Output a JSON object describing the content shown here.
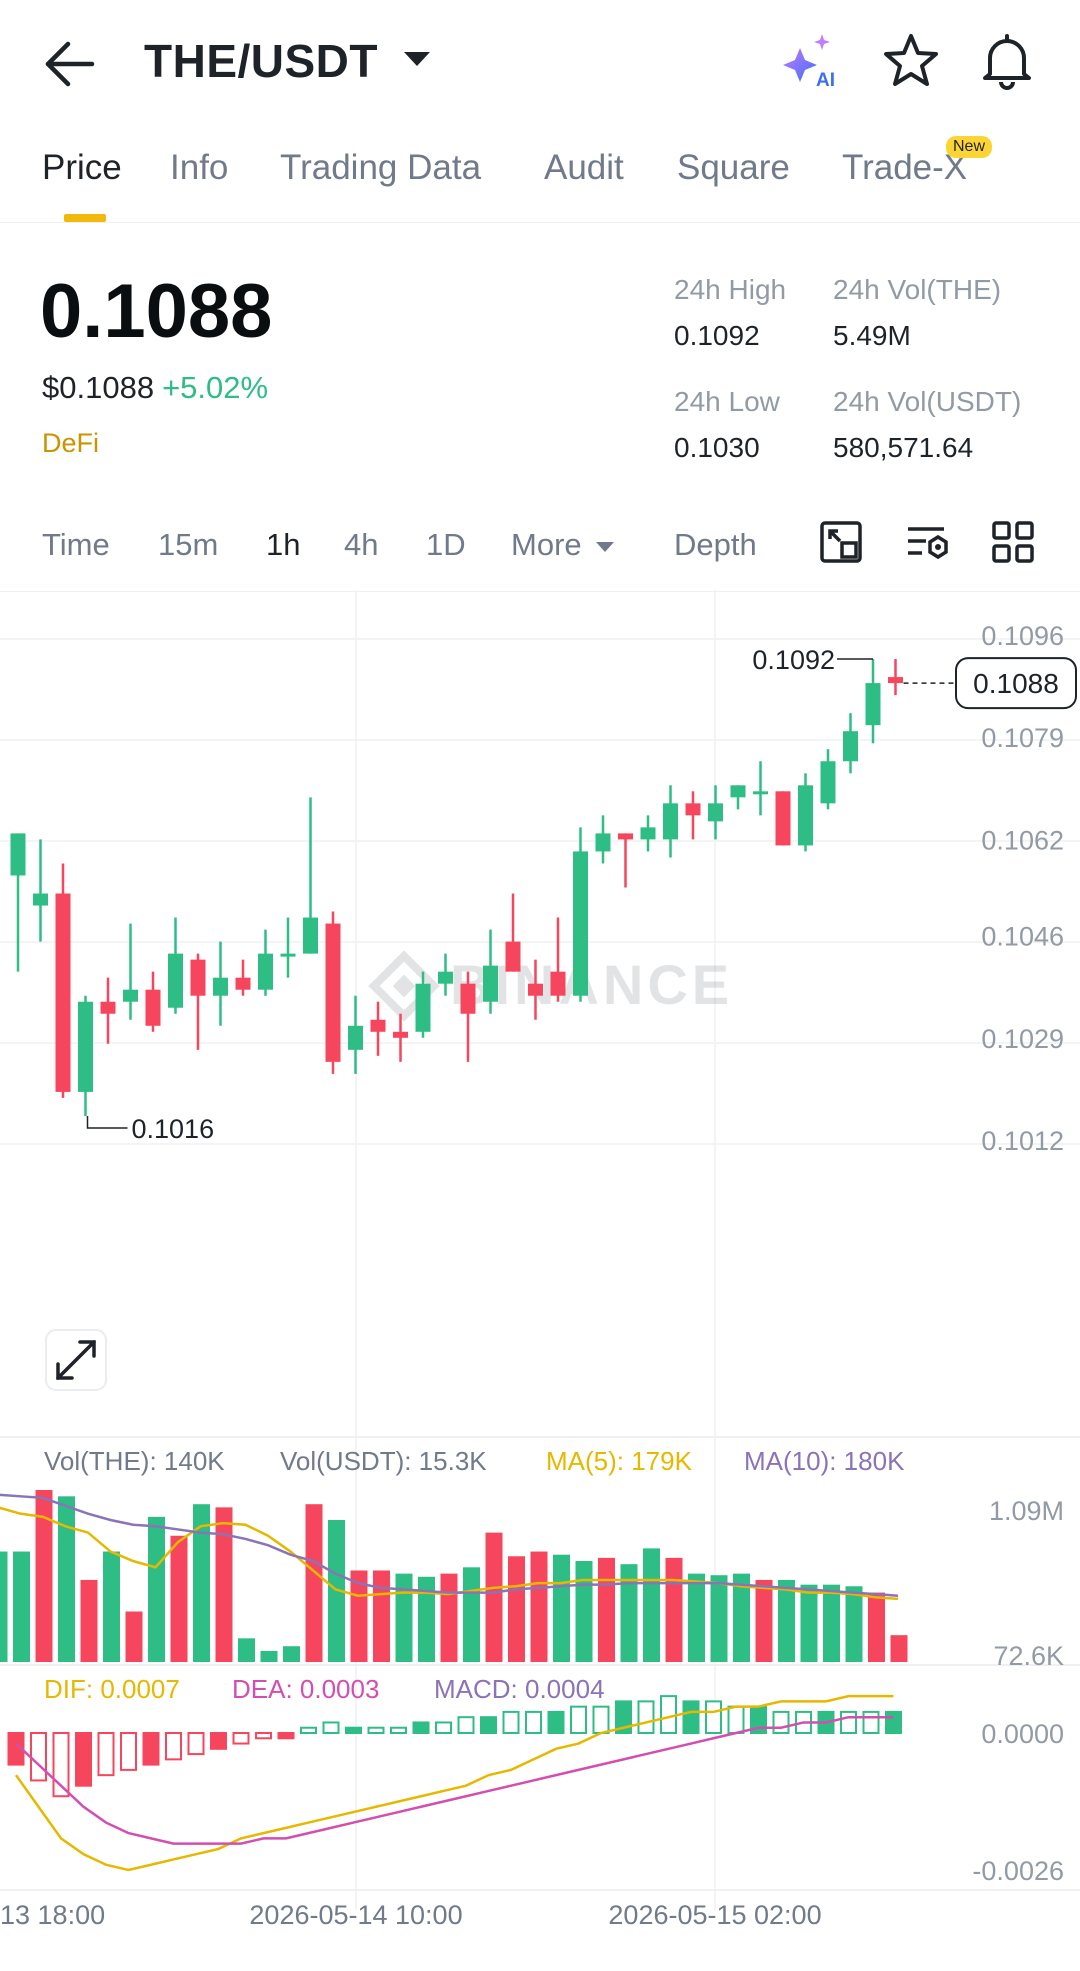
{
  "header": {
    "pair": "THE/USDT",
    "ai_label": "AI"
  },
  "tabs": [
    {
      "label": "Price",
      "active": true
    },
    {
      "label": "Info"
    },
    {
      "label": "Trading Data"
    },
    {
      "label": "Audit"
    },
    {
      "label": "Square"
    },
    {
      "label": "Trade-X",
      "badge": "New"
    }
  ],
  "price": {
    "last": "0.1088",
    "usd": "$0.1088",
    "change": "+5.02%",
    "tag": "DeFi",
    "stats": {
      "high_label": "24h High",
      "high": "0.1092",
      "vol_the_label": "24h Vol(THE)",
      "vol_the": "5.49M",
      "low_label": "24h Low",
      "low": "0.1030",
      "vol_usdt_label": "24h Vol(USDT)",
      "vol_usdt": "580,571.64"
    }
  },
  "intervals": {
    "items": [
      "Time",
      "15m",
      "1h",
      "4h",
      "1D"
    ],
    "active": "1h",
    "more": "More",
    "depth": "Depth"
  },
  "colors": {
    "up": "#2ebd85",
    "down": "#f6465d",
    "ma5": "#e6b800",
    "ma10": "#8b73b8",
    "dea": "#d24fb0",
    "accent": "#f0b90b"
  },
  "chart_data": [
    {
      "type": "candlestick",
      "interval": "1h",
      "watermark": "BINANCE",
      "y_ticks": [
        "0.1096",
        "0.1079",
        "0.1062",
        "0.1046",
        "0.1029",
        "0.1012"
      ],
      "ylim": [
        0.1012,
        0.1096
      ],
      "last_price_label": "0.1088",
      "high_marker": "0.1092",
      "low_marker": "0.1016",
      "x_tick_labels": [
        "13 18:00",
        "2026-05-14 10:00",
        "2026-05-15 02:00"
      ],
      "candles": [
        {
          "o": 0.1056,
          "h": 0.1062,
          "l": 0.104,
          "c": 0.1063
        },
        {
          "o": 0.1051,
          "h": 0.1062,
          "l": 0.1045,
          "c": 0.1053
        },
        {
          "o": 0.1053,
          "h": 0.1058,
          "l": 0.1019,
          "c": 0.102
        },
        {
          "o": 0.102,
          "h": 0.1036,
          "l": 0.1016,
          "c": 0.1035
        },
        {
          "o": 0.1035,
          "h": 0.1039,
          "l": 0.1028,
          "c": 0.1033
        },
        {
          "o": 0.1035,
          "h": 0.1048,
          "l": 0.1032,
          "c": 0.1037
        },
        {
          "o": 0.1037,
          "h": 0.104,
          "l": 0.103,
          "c": 0.1031
        },
        {
          "o": 0.1034,
          "h": 0.1049,
          "l": 0.1033,
          "c": 0.1043
        },
        {
          "o": 0.1042,
          "h": 0.1043,
          "l": 0.1027,
          "c": 0.1036
        },
        {
          "o": 0.1036,
          "h": 0.1045,
          "l": 0.1031,
          "c": 0.1039
        },
        {
          "o": 0.1039,
          "h": 0.1042,
          "l": 0.1036,
          "c": 0.1037
        },
        {
          "o": 0.1037,
          "h": 0.1047,
          "l": 0.1036,
          "c": 0.1043
        },
        {
          "o": 0.1043,
          "h": 0.1049,
          "l": 0.1039,
          "c": 0.1043
        },
        {
          "o": 0.1043,
          "h": 0.1069,
          "l": 0.1043,
          "c": 0.1049
        },
        {
          "o": 0.1048,
          "h": 0.105,
          "l": 0.1023,
          "c": 0.1025
        },
        {
          "o": 0.1027,
          "h": 0.1036,
          "l": 0.1023,
          "c": 0.1031
        },
        {
          "o": 0.1032,
          "h": 0.1035,
          "l": 0.1026,
          "c": 0.103
        },
        {
          "o": 0.103,
          "h": 0.1033,
          "l": 0.1025,
          "c": 0.1029
        },
        {
          "o": 0.103,
          "h": 0.104,
          "l": 0.1029,
          "c": 0.1038
        },
        {
          "o": 0.1038,
          "h": 0.1043,
          "l": 0.1036,
          "c": 0.104
        },
        {
          "o": 0.1038,
          "h": 0.104,
          "l": 0.1025,
          "c": 0.1033
        },
        {
          "o": 0.1035,
          "h": 0.1047,
          "l": 0.1033,
          "c": 0.1041
        },
        {
          "o": 0.1045,
          "h": 0.1053,
          "l": 0.104,
          "c": 0.104
        },
        {
          "o": 0.1038,
          "h": 0.1042,
          "l": 0.1032,
          "c": 0.1036
        },
        {
          "o": 0.104,
          "h": 0.1049,
          "l": 0.1035,
          "c": 0.1036
        },
        {
          "o": 0.1036,
          "h": 0.1064,
          "l": 0.1035,
          "c": 0.106
        },
        {
          "o": 0.106,
          "h": 0.1066,
          "l": 0.1058,
          "c": 0.1063
        },
        {
          "o": 0.1063,
          "h": 0.1063,
          "l": 0.1054,
          "c": 0.1062
        },
        {
          "o": 0.1062,
          "h": 0.1066,
          "l": 0.106,
          "c": 0.1064
        },
        {
          "o": 0.1062,
          "h": 0.1071,
          "l": 0.1059,
          "c": 0.1068
        },
        {
          "o": 0.1068,
          "h": 0.107,
          "l": 0.1062,
          "c": 0.1066
        },
        {
          "o": 0.1065,
          "h": 0.1071,
          "l": 0.1062,
          "c": 0.1068
        },
        {
          "o": 0.1069,
          "h": 0.1071,
          "l": 0.1067,
          "c": 0.1071
        },
        {
          "o": 0.107,
          "h": 0.1075,
          "l": 0.1066,
          "c": 0.107
        },
        {
          "o": 0.107,
          "h": 0.1069,
          "l": 0.1061,
          "c": 0.1061
        },
        {
          "o": 0.1061,
          "h": 0.1073,
          "l": 0.106,
          "c": 0.1071
        },
        {
          "o": 0.1068,
          "h": 0.1077,
          "l": 0.1067,
          "c": 0.1075
        },
        {
          "o": 0.1075,
          "h": 0.1083,
          "l": 0.1073,
          "c": 0.108
        },
        {
          "o": 0.1081,
          "h": 0.1092,
          "l": 0.1078,
          "c": 0.1088
        },
        {
          "o": 0.1089,
          "h": 0.1092,
          "l": 0.1086,
          "c": 0.1088
        }
      ]
    },
    {
      "type": "bar",
      "name": "Volume",
      "legend": {
        "vol_the": "Vol(THE): 140K",
        "vol_usdt": "Vol(USDT): 15.3K",
        "ma5": "MA(5): 179K",
        "ma10": "MA(10): 180K"
      },
      "y_ticks": [
        "1.09M",
        "72.6K"
      ],
      "values_k": [
        700,
        700,
        1090,
        1050,
        520,
        700,
        320,
        920,
        800,
        1000,
        980,
        150,
        70,
        100,
        1000,
        900,
        580,
        580,
        560,
        540,
        560,
        600,
        820,
        670,
        700,
        680,
        640,
        660,
        620,
        720,
        660,
        560,
        550,
        560,
        520,
        520,
        490,
        490,
        480,
        440,
        170
      ],
      "ma5_k": [
        980,
        940,
        920,
        860,
        820,
        700,
        640,
        600,
        760,
        860,
        880,
        870,
        800,
        700,
        580,
        460,
        420,
        430,
        440,
        440,
        430,
        450,
        470,
        480,
        500,
        500,
        520,
        520,
        520,
        520,
        520,
        510,
        500,
        480,
        470,
        460,
        440,
        440,
        430,
        410,
        400
      ],
      "ma10_k": [
        1060,
        1050,
        1040,
        990,
        940,
        900,
        870,
        860,
        840,
        820,
        810,
        780,
        740,
        680,
        640,
        560,
        500,
        470,
        460,
        450,
        440,
        440,
        440,
        460,
        470,
        480,
        490,
        490,
        500,
        500,
        500,
        500,
        500,
        490,
        480,
        470,
        460,
        450,
        440,
        430,
        420
      ]
    },
    {
      "type": "bar",
      "name": "MACD",
      "legend": {
        "dif": "DIF: 0.0007",
        "dea": "DEA: 0.0003",
        "macd": "MACD: 0.0004"
      },
      "y_ticks": [
        "0.0000",
        "-0.0026"
      ],
      "macd": [
        -0.0006,
        -0.0009,
        -0.0012,
        -0.001,
        -0.0008,
        -0.0007,
        -0.0006,
        -0.0005,
        -0.0004,
        -0.0003,
        -0.0002,
        -0.0001,
        -0.0001,
        0.0001,
        0.0002,
        0.0001,
        0.0001,
        0.0001,
        0.0002,
        0.0002,
        0.0003,
        0.0003,
        0.0004,
        0.0004,
        0.0004,
        0.0005,
        0.0005,
        0.0006,
        0.0006,
        0.0007,
        0.0006,
        0.0006,
        0.0005,
        0.0005,
        0.0004,
        0.0004,
        0.0004,
        0.0004,
        0.0004,
        0.0004
      ],
      "dif": [
        -0.0008,
        -0.0014,
        -0.002,
        -0.0023,
        -0.0025,
        -0.0026,
        -0.0025,
        -0.0024,
        -0.0023,
        -0.0022,
        -0.002,
        -0.0019,
        -0.0018,
        -0.0017,
        -0.0016,
        -0.0015,
        -0.0014,
        -0.0013,
        -0.0012,
        -0.0011,
        -0.001,
        -0.0008,
        -0.0007,
        -0.0005,
        -0.0003,
        -0.0002,
        0.0,
        0.0001,
        0.0002,
        0.0003,
        0.0004,
        0.0004,
        0.0005,
        0.0005,
        0.0006,
        0.0006,
        0.0006,
        0.0007,
        0.0007,
        0.0007
      ],
      "dea": [
        -0.0002,
        -0.0006,
        -0.001,
        -0.0014,
        -0.0017,
        -0.0019,
        -0.002,
        -0.0021,
        -0.0021,
        -0.0021,
        -0.0021,
        -0.002,
        -0.002,
        -0.0019,
        -0.0018,
        -0.0017,
        -0.0016,
        -0.0015,
        -0.0014,
        -0.0013,
        -0.0012,
        -0.0011,
        -0.001,
        -0.0009,
        -0.0008,
        -0.0007,
        -0.0006,
        -0.0005,
        -0.0004,
        -0.0003,
        -0.0002,
        -0.0001,
        0.0,
        0.0001,
        0.0001,
        0.0002,
        0.0002,
        0.0003,
        0.0003,
        0.0003
      ]
    }
  ]
}
